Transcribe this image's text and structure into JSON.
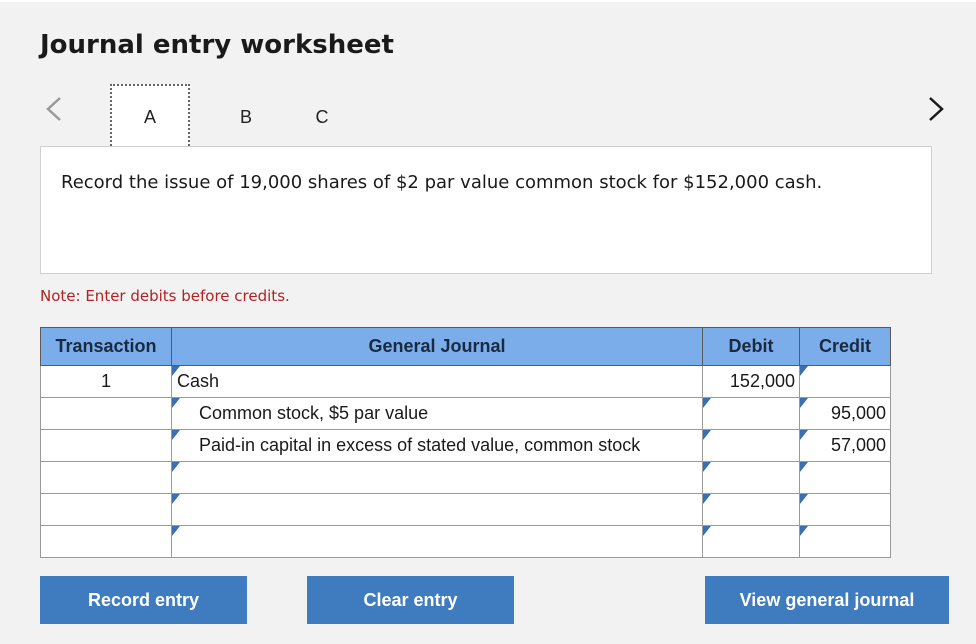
{
  "title": "Journal entry worksheet",
  "tabs": [
    {
      "label": "A",
      "active": true
    },
    {
      "label": "B",
      "active": false
    },
    {
      "label": "C",
      "active": false
    }
  ],
  "description": "Record the issue of 19,000 shares of $2 par value common stock for $152,000 cash.",
  "note": "Note: Enter debits before credits.",
  "table": {
    "headers": {
      "transaction": "Transaction",
      "general_journal": "General Journal",
      "debit": "Debit",
      "credit": "Credit"
    },
    "rows": [
      {
        "transaction": "1",
        "account": "Cash",
        "debit": "152,000",
        "credit": ""
      },
      {
        "transaction": "",
        "account": "Common stock, $5 par value",
        "debit": "",
        "credit": "95,000"
      },
      {
        "transaction": "",
        "account": "Paid-in capital in excess of stated value, common stock",
        "debit": "",
        "credit": "57,000"
      },
      {
        "transaction": "",
        "account": "",
        "debit": "",
        "credit": ""
      },
      {
        "transaction": "",
        "account": "",
        "debit": "",
        "credit": ""
      },
      {
        "transaction": "",
        "account": "",
        "debit": "",
        "credit": ""
      }
    ]
  },
  "buttons": {
    "record": "Record entry",
    "clear": "Clear entry",
    "view": "View general journal"
  },
  "colors": {
    "header_bg": "#7badea",
    "button_bg": "#3f7bbf",
    "note_text": "#b22222"
  },
  "icons": {
    "prev": "chevron-left-icon",
    "next": "chevron-right-icon"
  }
}
